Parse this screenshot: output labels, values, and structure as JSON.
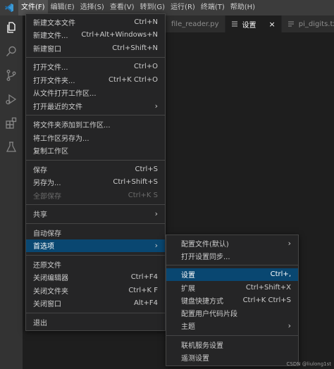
{
  "menubar": {
    "items": [
      "文件(F)",
      "编辑(E)",
      "选择(S)",
      "查看(V)",
      "转到(G)",
      "运行(R)",
      "终端(T)",
      "帮助(H)"
    ]
  },
  "tabs": [
    {
      "label": "file_reader.py"
    },
    {
      "label": "设置",
      "close": "×"
    },
    {
      "label": "pi_digits.txt"
    }
  ],
  "file_menu": [
    {
      "label": "新建文本文件",
      "shortcut": "Ctrl+N"
    },
    {
      "label": "新建文件...",
      "shortcut": "Ctrl+Alt+Windows+N"
    },
    {
      "label": "新建窗口",
      "shortcut": "Ctrl+Shift+N"
    },
    {
      "sep": true
    },
    {
      "label": "打开文件...",
      "shortcut": "Ctrl+O"
    },
    {
      "label": "打开文件夹...",
      "shortcut": "Ctrl+K Ctrl+O"
    },
    {
      "label": "从文件打开工作区..."
    },
    {
      "label": "打开最近的文件",
      "submenu": true
    },
    {
      "sep": true
    },
    {
      "label": "将文件夹添加到工作区..."
    },
    {
      "label": "将工作区另存为..."
    },
    {
      "label": "复制工作区"
    },
    {
      "sep": true
    },
    {
      "label": "保存",
      "shortcut": "Ctrl+S"
    },
    {
      "label": "另存为...",
      "shortcut": "Ctrl+Shift+S"
    },
    {
      "label": "全部保存",
      "shortcut": "Ctrl+K S",
      "disabled": true
    },
    {
      "sep": true
    },
    {
      "label": "共享",
      "submenu": true
    },
    {
      "sep": true
    },
    {
      "label": "自动保存"
    },
    {
      "label": "首选项",
      "submenu": true,
      "highlight": true
    },
    {
      "sep": true
    },
    {
      "label": "还原文件"
    },
    {
      "label": "关闭编辑器",
      "shortcut": "Ctrl+F4"
    },
    {
      "label": "关闭文件夹",
      "shortcut": "Ctrl+K F"
    },
    {
      "label": "关闭窗口",
      "shortcut": "Alt+F4"
    },
    {
      "sep": true
    },
    {
      "label": "退出"
    }
  ],
  "prefs_menu": [
    {
      "label": "配置文件(默认)",
      "submenu": true
    },
    {
      "label": "打开设置同步..."
    },
    {
      "sep": true
    },
    {
      "label": "设置",
      "shortcut": "Ctrl+,",
      "highlight": true
    },
    {
      "label": "扩展",
      "shortcut": "Ctrl+Shift+X"
    },
    {
      "label": "键盘快捷方式",
      "shortcut": "Ctrl+K Ctrl+S"
    },
    {
      "label": "配置用户代码片段"
    },
    {
      "label": "主题",
      "submenu": true
    },
    {
      "sep": true
    },
    {
      "label": "联机服务设置"
    },
    {
      "label": "遥测设置"
    }
  ],
  "watermark": "CSDN @liulong1st",
  "colors": {
    "accent": "#094771",
    "menubar": "#3c3c3c",
    "activity_bar": "#333333",
    "vscode_blue": "#3c99d4"
  }
}
